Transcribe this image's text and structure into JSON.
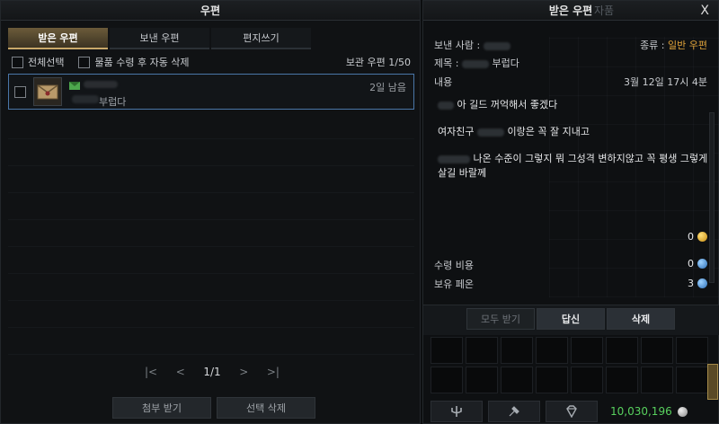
{
  "left": {
    "title": "우편",
    "tabs": [
      "받은 우편",
      "보낸 우편",
      "편지쓰기"
    ],
    "select_all": "전체선택",
    "auto_delete": "물품 수령 후 자동 삭제",
    "storage_count": "보관 우편 1/50",
    "mail": {
      "subject": "부럽다",
      "days_left": "2일 남음"
    },
    "pager": {
      "first": "|<",
      "prev": "<",
      "page": "1/1",
      "next": ">",
      "last": ">|"
    },
    "buttons": {
      "receive_attach": "첨부 받기",
      "delete_selected": "선택 삭제"
    }
  },
  "right": {
    "title": "받은 우편",
    "ghost_tab": "자품",
    "close": "X",
    "sender_label": "보낸 사람 :",
    "type_label": "종류 :",
    "type_value": "일반 우편",
    "subject_label": "제목 :",
    "subject_value": "부럽다",
    "content_label": "내용",
    "date": "3월 12일 17시 4분",
    "content": [
      "아 길드 꺼억해서 좋겠다",
      "여자친구",
      "이랑은 꼭 잘 지내고",
      "나온 수준이 그렇지 뭐 그성격 변하지않고 꼭 평생 그렇게",
      "살길 바랄께"
    ],
    "gold_value": "0",
    "receive_cost_label": "수령 비용",
    "receive_cost_value": "0",
    "owned_label": "보유 페온",
    "owned_value": "3",
    "buttons": {
      "receive_all": "모두 받기",
      "reply": "답신",
      "delete": "삭제"
    },
    "money": "10,030,196"
  },
  "colors": {
    "accent_gold": "#e0a33a",
    "money_green": "#58d15e",
    "selection_border": "#4a76a8"
  }
}
